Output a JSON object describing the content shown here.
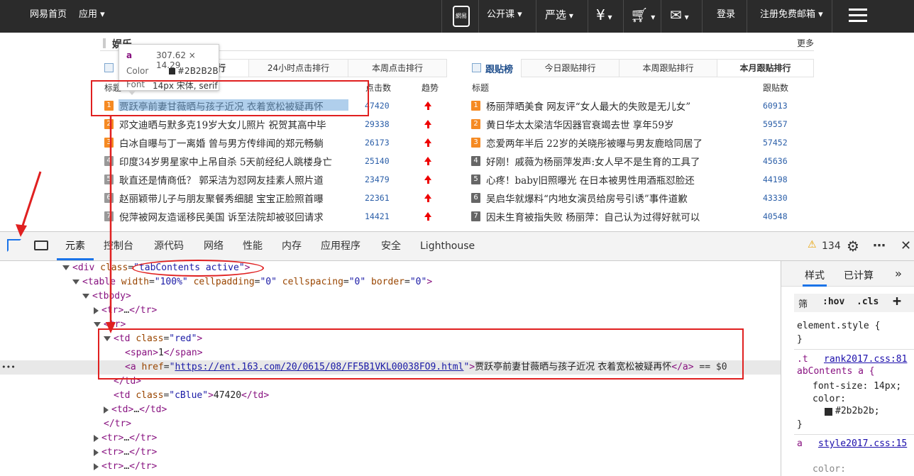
{
  "nav": {
    "home": "网易首页",
    "apps": "应用",
    "logo": "網易",
    "open_course": "公开课",
    "yanxuan": "严选",
    "login": "登录",
    "register": "注册免费邮箱"
  },
  "section": {
    "title": "娱乐",
    "more": "更多"
  },
  "left": {
    "tabs": [
      "点击排行",
      "24小时点击排行",
      "本周点击排行"
    ],
    "col_title": "标题",
    "col_clicks": "点击数",
    "col_trend": "趋势",
    "rows": [
      {
        "rank": "1",
        "text": "贾跃亭前妻甘薇晒与孩子近况 衣着宽松被疑再怀",
        "count": "47420"
      },
      {
        "rank": "2",
        "text": "邓文迪晒与默多克19岁大女儿照片 祝贺其高中毕",
        "count": "29338"
      },
      {
        "rank": "3",
        "text": "白冰自曝与丁一离婚 曾与男方传绯闻的郑元畅躺",
        "count": "26173"
      },
      {
        "rank": "4",
        "text": "印度34岁男星家中上吊自杀 5天前经纪人跳楼身亡",
        "count": "25140"
      },
      {
        "rank": "5",
        "text": "耿直还是情商低？ 郭采洁为怼网友挂素人照片道",
        "count": "23479"
      },
      {
        "rank": "6",
        "text": "赵丽颖带儿子与朋友聚餐秀细腿 宝宝正脸照首曝",
        "count": "22361"
      },
      {
        "rank": "7",
        "text": "倪萍被网友造谣移民美国 诉至法院却被驳回请求",
        "count": "14421"
      }
    ]
  },
  "right": {
    "title": "跟贴榜",
    "tabs": [
      "今日跟贴排行",
      "本周跟贴排行",
      "本月跟贴排行"
    ],
    "col_title": "标题",
    "col_count": "跟贴数",
    "rows": [
      {
        "rank": "1",
        "text": "杨丽萍晒美食 网友评“女人最大的失败是无儿女”",
        "count": "60913"
      },
      {
        "rank": "2",
        "text": "黄日华太太梁洁华因器官衰竭去世 享年59岁",
        "count": "59557"
      },
      {
        "rank": "3",
        "text": "恋爱两年半后 22岁的关晓彤被曝与男友鹿晗同居了",
        "count": "57452"
      },
      {
        "rank": "4",
        "text": "好刚！戚薇为杨丽萍发声:女人早不是生育的工具了",
        "count": "45636"
      },
      {
        "rank": "5",
        "text": "心疼！baby旧照曝光 在日本被男性用酒瓶怼脸还",
        "count": "44198"
      },
      {
        "rank": "6",
        "text": "吴启华就爆料“内地女演员给房号引诱”事件道歉",
        "count": "43330"
      },
      {
        "rank": "7",
        "text": "因未生育被指失败 杨丽萍：自己认为过得好就可以",
        "count": "40548"
      }
    ]
  },
  "tooltip": {
    "tag": "a",
    "size": "307.62 × 14.29",
    "color_label": "Color",
    "color_value": "#2B2B2B",
    "font_label": "Font",
    "font_value": "14px 宋体, serif"
  },
  "devtools": {
    "tabs": [
      "元素",
      "控制台",
      "源代码",
      "网络",
      "性能",
      "内存",
      "应用程序",
      "安全",
      "Lighthouse"
    ],
    "warnings": "134",
    "side_tabs": [
      "样式",
      "已计算"
    ],
    "filter": "筛",
    "hov": ":hov",
    "cls": ".cls",
    "element_style": "element.style {",
    "close_brace": "}",
    "rule1_selector": ".t",
    "rule1_selector2": "abContents a {",
    "rule1_source": "rank2017.css:81",
    "rule1_fontsize": "font-size: 14px;",
    "rule1_color": "color:",
    "rule1_colorval": "#2b2b2b;",
    "rule2_selector": "a",
    "rule2_source": "style2017.css:15",
    "rule2_color": "color:",
    "dots": "•••",
    "href": "https://ent.163.com/20/0615/08/FF5B1VKL00038FO9.html",
    "link_text": "贾跃亭前妻甘薇晒与孩子近况 衣着宽松被疑再怀"
  },
  "colors": {
    "accent": "#e02020",
    "rank_top": "#f58a23",
    "rank_other": "#999999",
    "link": "#2a5ea8",
    "nav_bg": "#2b2b2b"
  }
}
